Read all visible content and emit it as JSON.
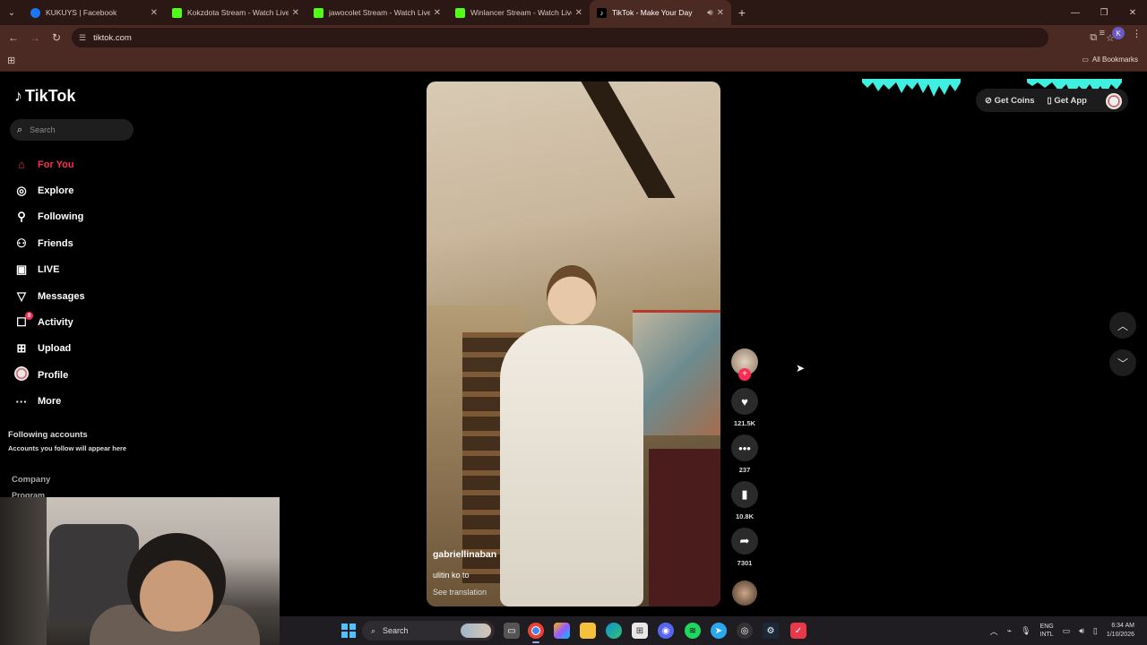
{
  "browser": {
    "tabs": [
      {
        "title": "KUKUYS | Facebook",
        "color": "#1877f2",
        "icon": "facebook-icon"
      },
      {
        "title": "Kokzdota Stream - Watch Live",
        "color": "#53fc18",
        "icon": "kick-icon"
      },
      {
        "title": "jawocolet Stream - Watch Live",
        "color": "#53fc18",
        "icon": "kick-icon"
      },
      {
        "title": "Winlancer Stream - Watch Live",
        "color": "#53fc18",
        "icon": "kick-icon"
      },
      {
        "title": "TikTok - Make Your Day",
        "color": "#000000",
        "icon": "tiktok-icon",
        "active": true
      }
    ],
    "url": "tiktok.com",
    "profile_initial": "K",
    "bookmarks_label": "All Bookmarks"
  },
  "tiktok": {
    "logo": "TikTok",
    "search_placeholder": "Search",
    "nav": [
      {
        "label": "For You",
        "icon": "home-icon",
        "active": true
      },
      {
        "label": "Explore",
        "icon": "compass-icon"
      },
      {
        "label": "Following",
        "icon": "following-icon"
      },
      {
        "label": "Friends",
        "icon": "friends-icon"
      },
      {
        "label": "LIVE",
        "icon": "live-icon"
      },
      {
        "label": "Messages",
        "icon": "messages-icon"
      },
      {
        "label": "Activity",
        "icon": "activity-icon",
        "badge": "8"
      },
      {
        "label": "Upload",
        "icon": "upload-icon"
      },
      {
        "label": "Profile",
        "icon": "profile-avatar"
      },
      {
        "label": "More",
        "icon": "more-icon"
      }
    ],
    "following_accounts_title": "Following accounts",
    "following_accounts_sub": "Accounts you follow will appear here",
    "company": "Company",
    "program": "Program",
    "top_right": {
      "get_coins": "Get Coins",
      "get_app": "Get App"
    },
    "video": {
      "username": "gabriellinaban",
      "caption": "ulitin ko to",
      "see_translation": "See translation"
    },
    "actions": {
      "likes": "121.5K",
      "comments": "237",
      "saves": "10.8K",
      "shares": "7301"
    },
    "accent": "#fe2c55"
  },
  "taskbar": {
    "search": "Search",
    "lang_line1": "ENG",
    "lang_line2": "INTL",
    "time": "6:34 AM",
    "date": "1/10/2026"
  }
}
